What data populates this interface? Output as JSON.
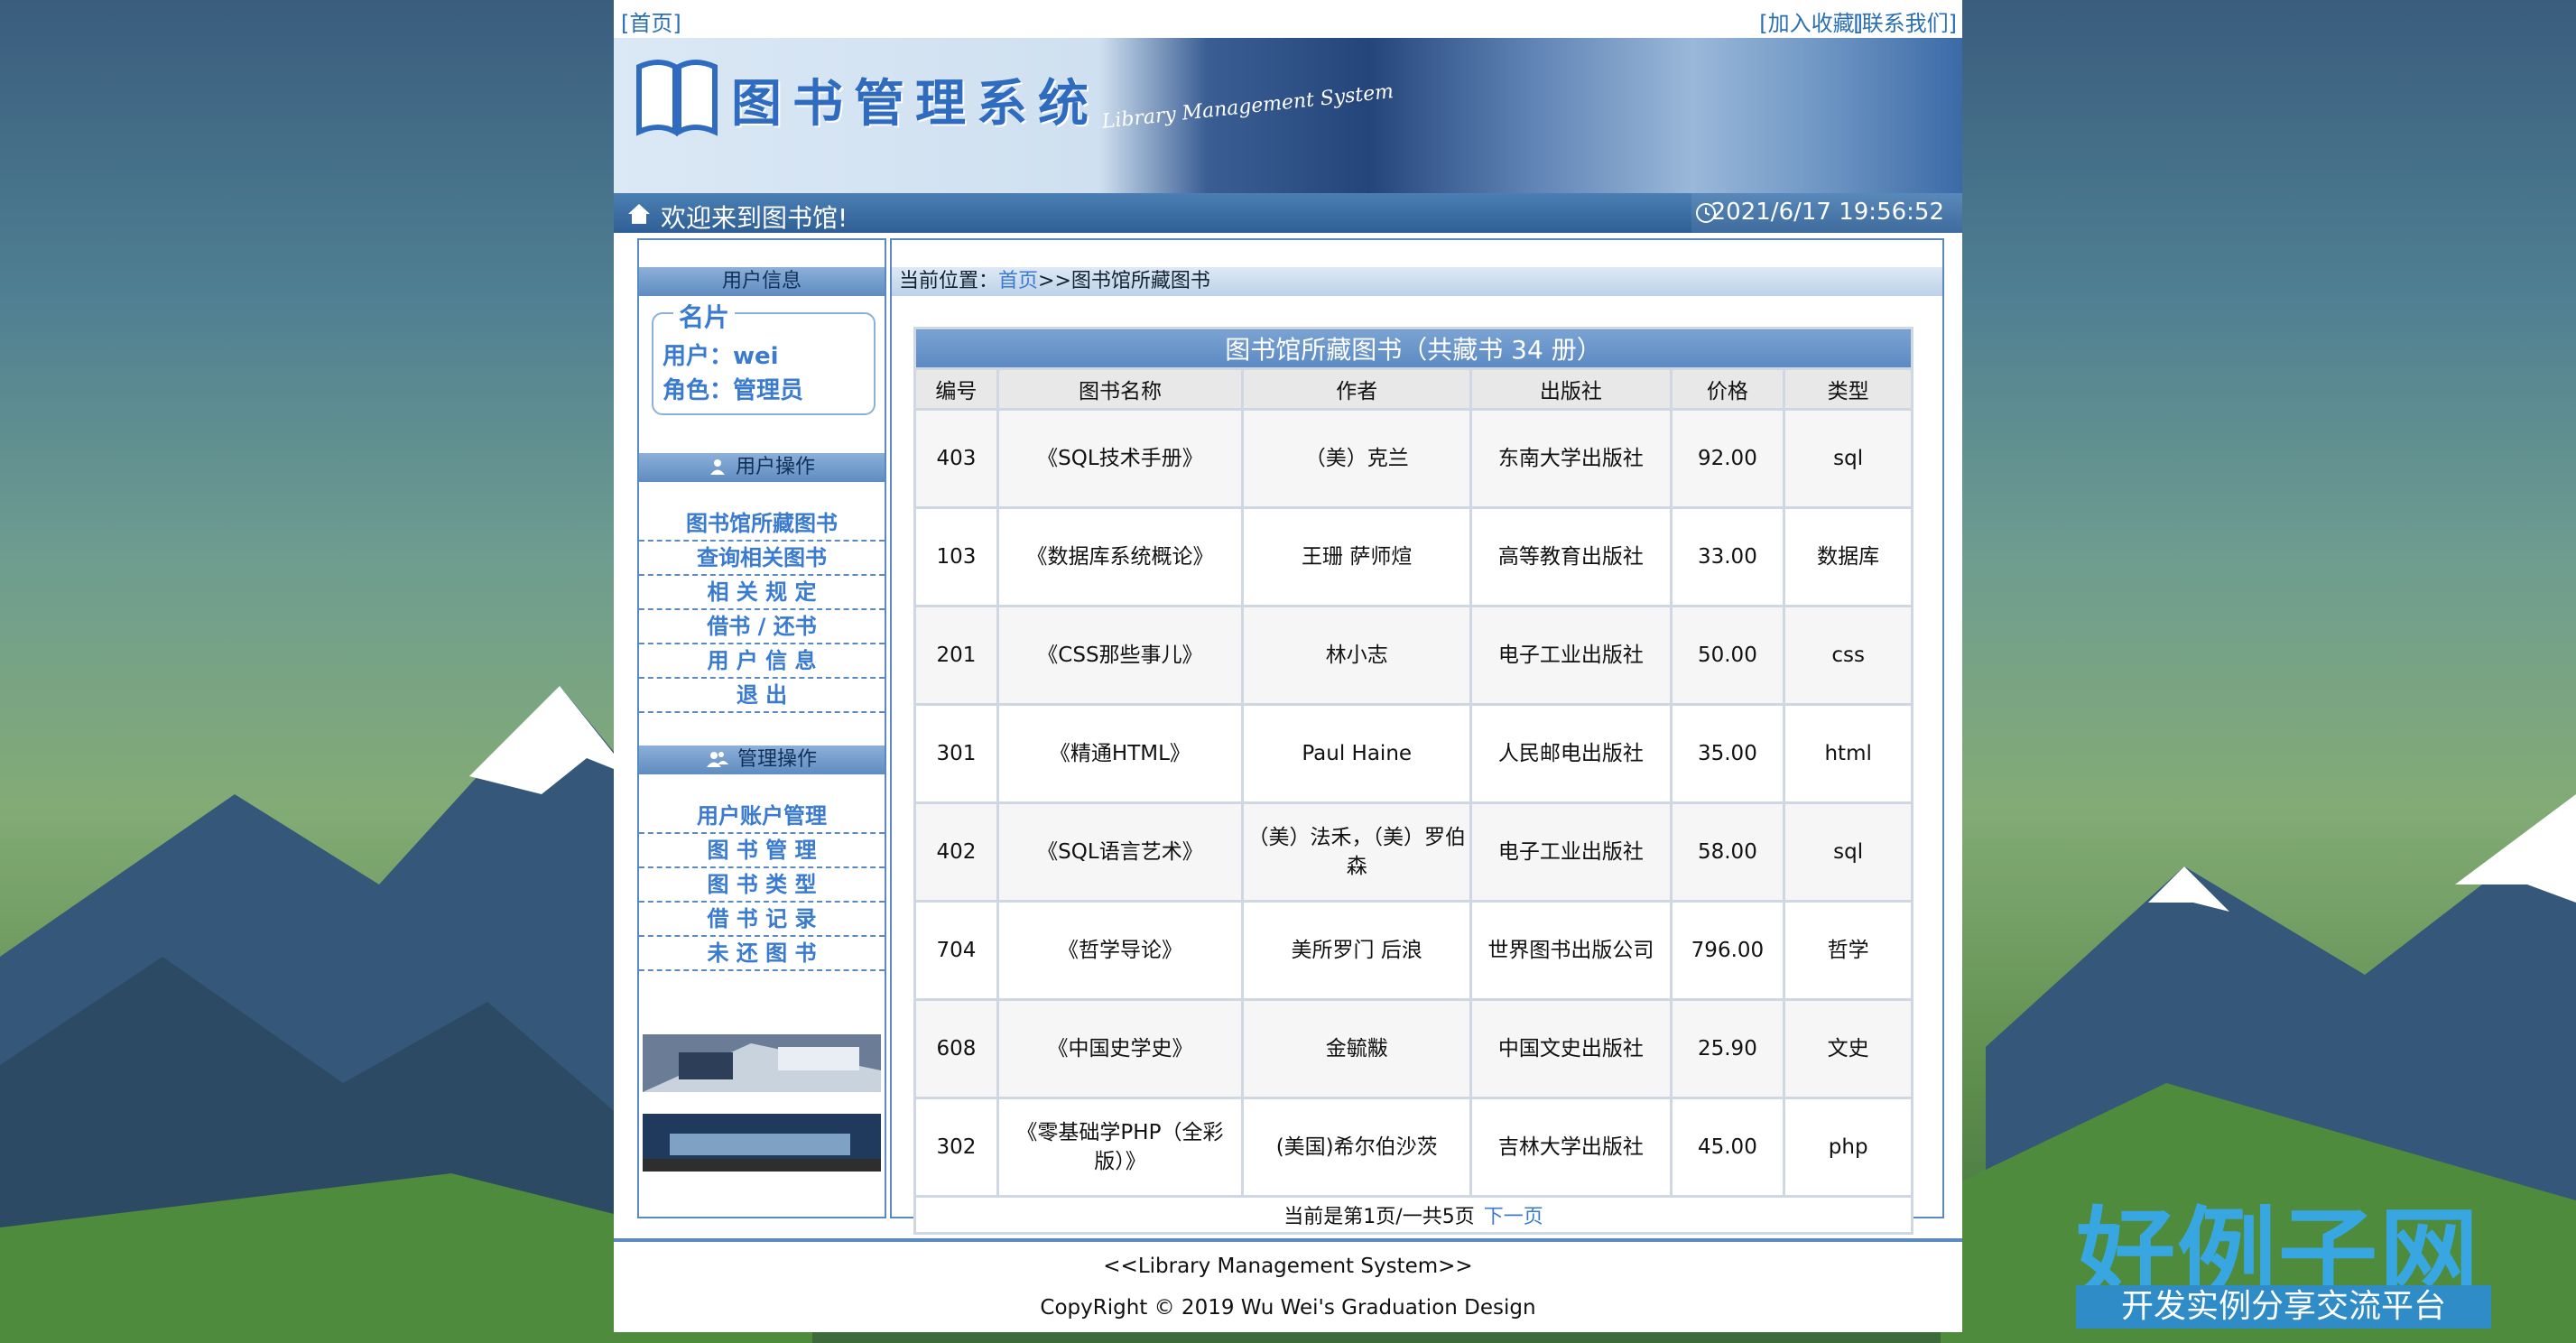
{
  "top_links": {
    "home": "[首页]",
    "favorite": "[加入收藏]",
    "contact": "[联系我们]"
  },
  "banner": {
    "title": "图书管理系统",
    "subtitle": "Library Management System"
  },
  "welcome": {
    "text": "欢迎来到图书馆!",
    "datetime": "2021/6/17 19:56:52"
  },
  "sidebar": {
    "user_info_header": "用户信息",
    "card": {
      "legend": "名片",
      "user_label": "用户：wei",
      "role_label": "角色：管理员"
    },
    "user_ops_header": "用户操作",
    "user_ops": [
      "图书馆所藏图书",
      "查询相关图书",
      "相 关 规 定",
      "借书 / 还书",
      "用 户 信 息",
      "退  出"
    ],
    "admin_ops_header": "管理操作",
    "admin_ops": [
      "用户账户管理",
      "图 书 管 理",
      "图 书 类 型",
      "借 书 记 录",
      "未 还 图 书"
    ]
  },
  "main": {
    "breadcrumb_prefix": "当前位置：",
    "breadcrumb_home": "首页",
    "breadcrumb_rest": ">>图书馆所藏图书",
    "table_caption": "图书馆所藏图书（共藏书 34 册）",
    "columns": [
      "编号",
      "图书名称",
      "作者",
      "出版社",
      "价格",
      "类型"
    ],
    "rows": [
      [
        "403",
        "《SQL技术手册》",
        "（美）克兰",
        "东南大学出版社",
        "92.00",
        "sql"
      ],
      [
        "103",
        "《数据库系统概论》",
        "王珊 萨师煊",
        "高等教育出版社",
        "33.00",
        "数据库"
      ],
      [
        "201",
        "《CSS那些事儿》",
        "林小志",
        "电子工业出版社",
        "50.00",
        "css"
      ],
      [
        "301",
        "《精通HTML》",
        "Paul Haine",
        "人民邮电出版社",
        "35.00",
        "html"
      ],
      [
        "402",
        "《SQL语言艺术》",
        "（美）法禾，（美）罗伯森",
        "电子工业出版社",
        "58.00",
        "sql"
      ],
      [
        "704",
        "《哲学导论》",
        "美所罗门 后浪",
        "世界图书出版公司",
        "796.00",
        "哲学"
      ],
      [
        "608",
        "《中国史学史》",
        "金毓黻",
        "中国文史出版社",
        "25.90",
        "文史"
      ],
      [
        "302",
        "《零基础学PHP（全彩版）》",
        "(美国)希尔伯沙茨",
        "吉林大学出版社",
        "45.00",
        "php"
      ]
    ],
    "pager_text": "当前是第1页/一共5页",
    "next_label": "下一页"
  },
  "footer": {
    "line1": "<<Library Management System>>",
    "line2": "CopyRight © 2019  Wu Wei's Graduation Design"
  },
  "watermark": {
    "brand": "好例子网",
    "tagline": "开发实例分享交流平台"
  },
  "colors": {
    "accent": "#5b89c2",
    "link": "#3a7bd0"
  }
}
